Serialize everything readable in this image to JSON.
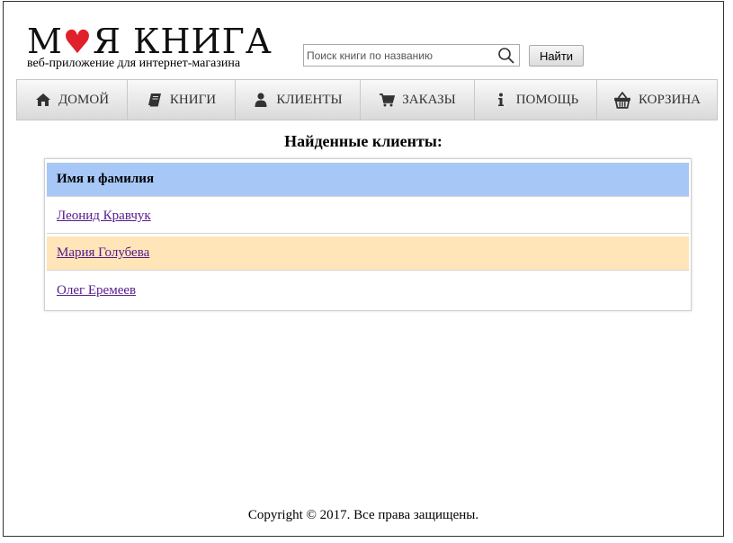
{
  "brand": {
    "title_part1": "М",
    "title_part2": "Я КНИГА",
    "subtitle": "веб-приложение для интернет-магазина",
    "accent_color": "#e0202a"
  },
  "search": {
    "placeholder": "Поиск книги по названию",
    "value": "",
    "button_label": "Найти"
  },
  "nav": {
    "items": [
      {
        "label": "ДОМОЙ",
        "icon": "home-icon"
      },
      {
        "label": "КНИГИ",
        "icon": "book-icon"
      },
      {
        "label": "КЛИЕНТЫ",
        "icon": "user-icon"
      },
      {
        "label": "ЗАКАЗЫ",
        "icon": "cart-icon"
      },
      {
        "label": "ПОМОЩЬ",
        "icon": "info-icon"
      },
      {
        "label": "КОРЗИНА",
        "icon": "basket-icon"
      }
    ]
  },
  "main": {
    "heading": "Найденные клиенты:",
    "table": {
      "header": "Имя и фамилия",
      "header_color": "#a7c7f7",
      "alt_row_color": "#ffe5b8",
      "rows": [
        "Леонид Кравчук",
        "Мария Голубева",
        "Олег Еремеев"
      ]
    }
  },
  "footer": {
    "text": "Copyright © 2017. Все права защищены."
  }
}
